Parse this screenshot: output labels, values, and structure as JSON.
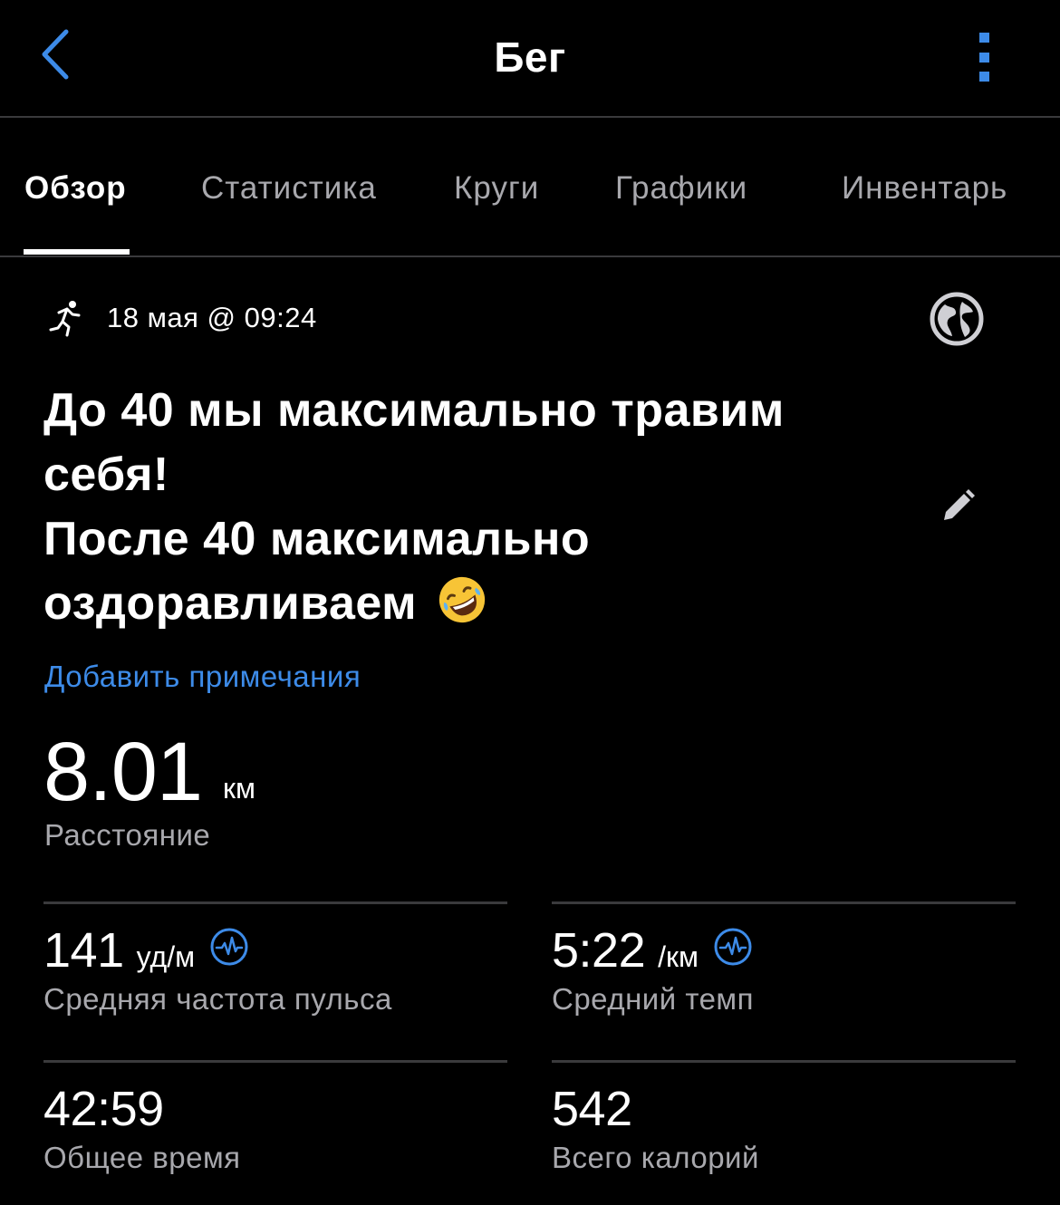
{
  "header": {
    "title": "Бег"
  },
  "tabs": [
    {
      "label": "Обзор",
      "active": true
    },
    {
      "label": "Статистика",
      "active": false
    },
    {
      "label": "Круги",
      "active": false
    },
    {
      "label": "Графики",
      "active": false
    },
    {
      "label": "Инвентарь",
      "active": false
    }
  ],
  "activity": {
    "datetime": "18 мая @ 09:24",
    "title_line1": "До 40 мы максимально травим",
    "title_line2": "себя!",
    "title_line3": "После 40 максимально",
    "title_line4": "оздоравливаем",
    "add_notes": "Добавить примечания"
  },
  "distance": {
    "value": "8.01",
    "unit": "км",
    "label": "Расстояние"
  },
  "stats": [
    {
      "value": "141",
      "unit": "уд/м",
      "label": "Средняя частота пульса",
      "icon": "heart-rate-icon"
    },
    {
      "value": "5:22",
      "unit": "/км",
      "label": "Средний темп",
      "icon": "pace-icon"
    },
    {
      "value": "42:59",
      "unit": "",
      "label": "Общее время"
    },
    {
      "value": "542",
      "unit": "",
      "label": "Всего калорий"
    }
  ],
  "colors": {
    "accent": "#3d8be8",
    "background": "#000000",
    "muted_text": "#a8a8ad",
    "divider": "#3a3a3c"
  }
}
